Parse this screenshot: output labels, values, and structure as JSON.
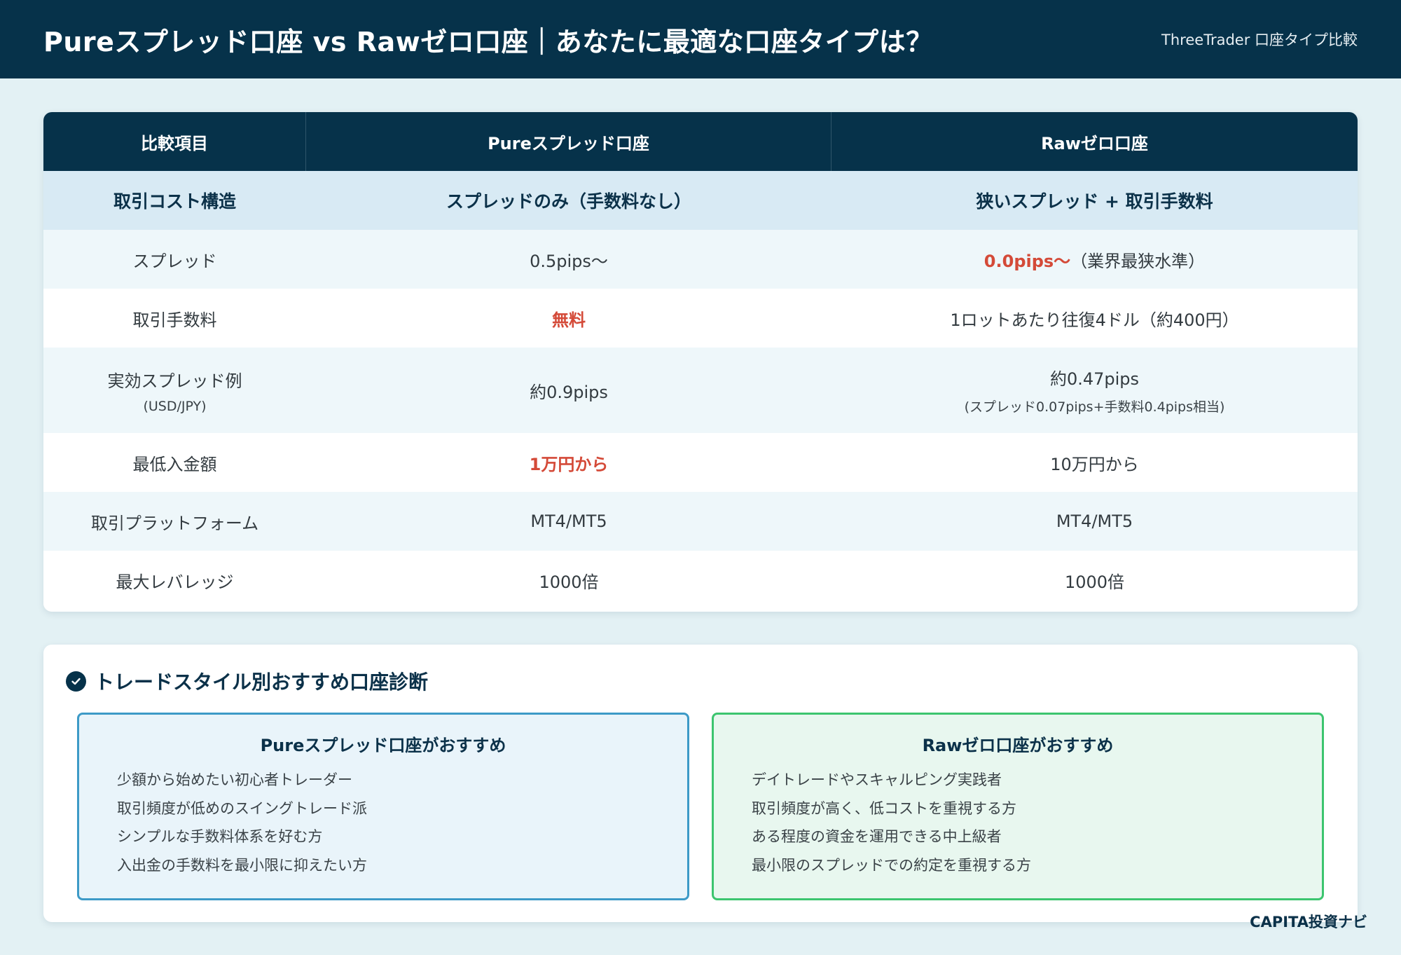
{
  "header": {
    "title": "Pureスプレッド口座 vs Rawゼロ口座｜あなたに最適な口座タイプは？",
    "subtitle": "ThreeTrader 口座タイプ比較"
  },
  "table": {
    "headers": [
      "比較項目",
      "Pureスプレッド口座",
      "Rawゼロ口座"
    ],
    "cost_structure": {
      "label": "取引コスト構造",
      "pure": "スプレッドのみ（手数料なし）",
      "raw": "狭いスプレッド + 取引手数料"
    },
    "rows": {
      "spread": {
        "label": "スプレッド",
        "pure": "0.5pips〜",
        "raw_highlight": "0.0pips〜",
        "raw_note": "（業界最狭水準）"
      },
      "commission": {
        "label": "取引手数料",
        "pure": "無料",
        "raw": "1ロットあたり往復4ドル（約400円）"
      },
      "effective": {
        "label": "実効スプレッド例",
        "label_sub": "(USD/JPY)",
        "pure": "約0.9pips",
        "raw": "約0.47pips",
        "raw_sub": "(スプレッド0.07pips+手数料0.4pips相当)"
      },
      "deposit": {
        "label": "最低入金額",
        "pure": "1万円から",
        "raw": "10万円から"
      },
      "platform": {
        "label": "取引プラットフォーム",
        "pure": "MT4/MT5",
        "raw": "MT4/MT5"
      },
      "leverage": {
        "label": "最大レバレッジ",
        "pure": "1000倍",
        "raw": "1000倍"
      }
    }
  },
  "recommend": {
    "title": "トレードスタイル別おすすめ口座診断",
    "icon": "check-circle-icon",
    "pure": {
      "heading": "Pureスプレッド口座がおすすめ",
      "items": [
        "少額から始めたい初心者トレーダー",
        "取引頻度が低めのスイングトレード派",
        "シンプルな手数料体系を好む方",
        "入出金の手数料を最小限に抑えたい方"
      ]
    },
    "raw": {
      "heading": "Rawゼロ口座がおすすめ",
      "items": [
        "デイトレードやスキャルピング実践者",
        "取引頻度が高く、低コストを重視する方",
        "ある程度の資金を運用できる中上級者",
        "最小限のスプレッドでの約定を重視する方"
      ]
    }
  },
  "footer": {
    "brand": "CAPITA投資ナビ"
  },
  "colors": {
    "navy": "#06324a",
    "highlight_red": "#d44a38",
    "pure_border": "#3d9ac7",
    "raw_border": "#3cc56f"
  }
}
